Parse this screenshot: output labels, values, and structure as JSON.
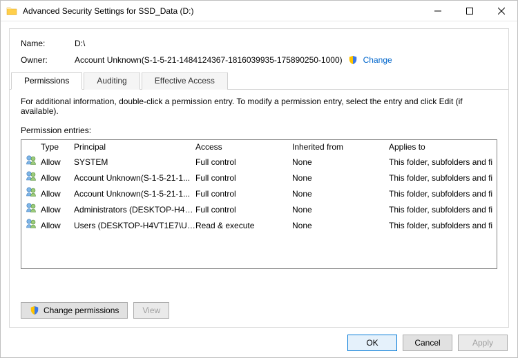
{
  "window": {
    "title": "Advanced Security Settings for SSD_Data (D:)"
  },
  "info": {
    "name_label": "Name:",
    "name_value": "D:\\",
    "owner_label": "Owner:",
    "owner_value": "Account Unknown(S-1-5-21-1484124367-1816039935-175890250-1000)",
    "change_link": "Change"
  },
  "tabs": {
    "permissions": "Permissions",
    "auditing": "Auditing",
    "effective_access": "Effective Access"
  },
  "instruction": "For additional information, double-click a permission entry. To modify a permission entry, select the entry and click Edit (if available).",
  "entries_label": "Permission entries:",
  "columns": {
    "type": "Type",
    "principal": "Principal",
    "access": "Access",
    "inherited": "Inherited from",
    "applies": "Applies to"
  },
  "entries": [
    {
      "type": "Allow",
      "principal": "SYSTEM",
      "access": "Full control",
      "inherited": "None",
      "applies": "This folder, subfolders and files"
    },
    {
      "type": "Allow",
      "principal": "Account Unknown(S-1-5-21-1...",
      "access": "Full control",
      "inherited": "None",
      "applies": "This folder, subfolders and files"
    },
    {
      "type": "Allow",
      "principal": "Account Unknown(S-1-5-21-1...",
      "access": "Full control",
      "inherited": "None",
      "applies": "This folder, subfolders and files"
    },
    {
      "type": "Allow",
      "principal": "Administrators (DESKTOP-H4V...",
      "access": "Full control",
      "inherited": "None",
      "applies": "This folder, subfolders and files"
    },
    {
      "type": "Allow",
      "principal": "Users (DESKTOP-H4VT1E7\\Use...",
      "access": "Read & execute",
      "inherited": "None",
      "applies": "This folder, subfolders and files"
    }
  ],
  "panel_buttons": {
    "change_permissions": "Change permissions",
    "view": "View"
  },
  "footer": {
    "ok": "OK",
    "cancel": "Cancel",
    "apply": "Apply"
  }
}
